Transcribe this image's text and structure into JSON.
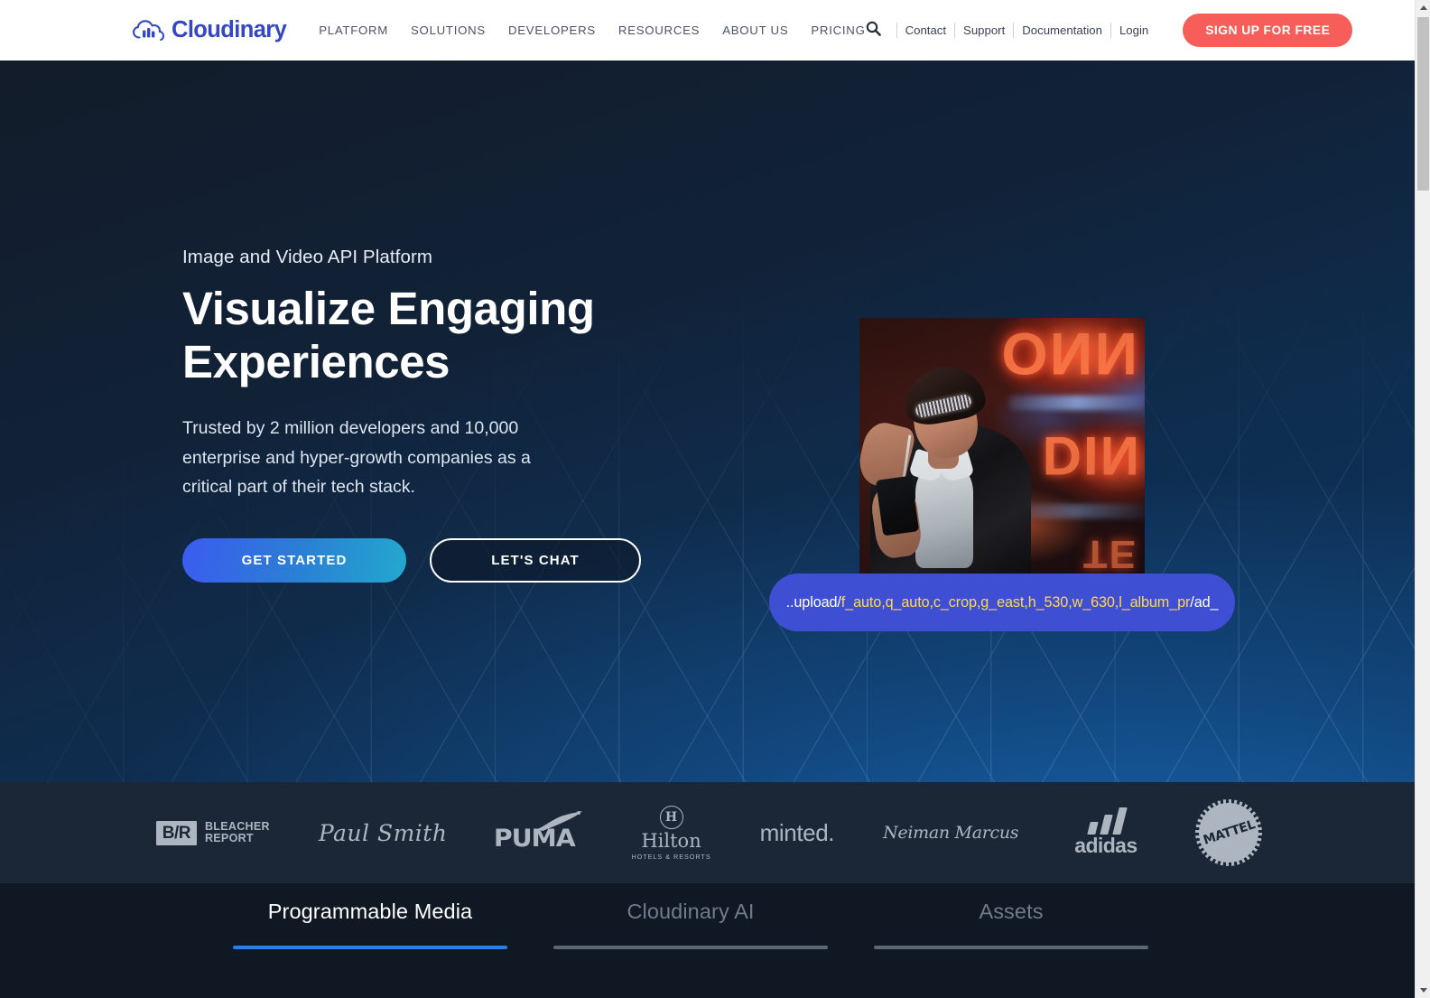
{
  "browser": {
    "scrollbar_up_icon": "caret-up-icon",
    "scrollbar_down_icon": "caret-down-icon"
  },
  "header": {
    "logo_text": "Cloudinary",
    "logo_icon": "cloudinary-cloud-icon",
    "nav": [
      {
        "label": "PLATFORM"
      },
      {
        "label": "SOLUTIONS"
      },
      {
        "label": "DEVELOPERS"
      },
      {
        "label": "RESOURCES"
      },
      {
        "label": "ABOUT US"
      },
      {
        "label": "PRICING"
      }
    ],
    "search_icon": "search-icon",
    "utility_links": [
      {
        "label": "Contact"
      },
      {
        "label": "Support"
      },
      {
        "label": "Documentation"
      },
      {
        "label": "Login"
      }
    ],
    "signup_label": "SIGN UP FOR FREE",
    "signup_color": "#f75e5a",
    "logo_color": "#3448c5"
  },
  "hero": {
    "eyebrow": "Image and Video API Platform",
    "title_line1": "Visualize Engaging",
    "title_line2": "Experiences",
    "subtitle": "Trusted by 2 million developers and 10,000 enterprise and hyper-growth companies as a critical part of their tech stack.",
    "cta_primary": "GET STARTED",
    "cta_secondary": "LET'S CHAT",
    "background_top_color": "#101a28",
    "background_bottom_color": "#0d3156",
    "media": {
      "image_alt": "woman-with-phone-neon-sign-photo",
      "url_bar": {
        "prefix": "..upload/",
        "params": "f_auto,q_auto,c_crop,g_east,h_530,w_630,l_album_pr",
        "suffix": "/ad_",
        "full_text": "..upload/f_auto,q_auto,c_crop,g_east,h_530,w_630,l_album_pr/ad_",
        "background_color": "#3f4fd4",
        "highlight_color": "#ffd84d"
      }
    }
  },
  "logos": {
    "background_color": "#1b2636",
    "items": [
      {
        "name": "bleacher-report",
        "mark": "B/R",
        "line1": "BLEACHER",
        "line2": "REPORT"
      },
      {
        "name": "paul-smith",
        "text": "Paul Smith"
      },
      {
        "name": "puma",
        "text": "PUMA"
      },
      {
        "name": "hilton",
        "crest": "H",
        "text": "Hilton",
        "sub": "HOTELS & RESORTS"
      },
      {
        "name": "minted",
        "text": "minted."
      },
      {
        "name": "neiman-marcus",
        "text": "Neiman Marcus"
      },
      {
        "name": "adidas",
        "text": "adidas"
      },
      {
        "name": "mattel",
        "text": "MATTEL"
      }
    ]
  },
  "tabs": {
    "background_color": "#0f1823",
    "active_indicator_color": "#2f7de3",
    "items": [
      {
        "label": "Programmable Media",
        "active": true
      },
      {
        "label": "Cloudinary AI",
        "active": false
      },
      {
        "label": "Assets",
        "active": false
      }
    ]
  }
}
